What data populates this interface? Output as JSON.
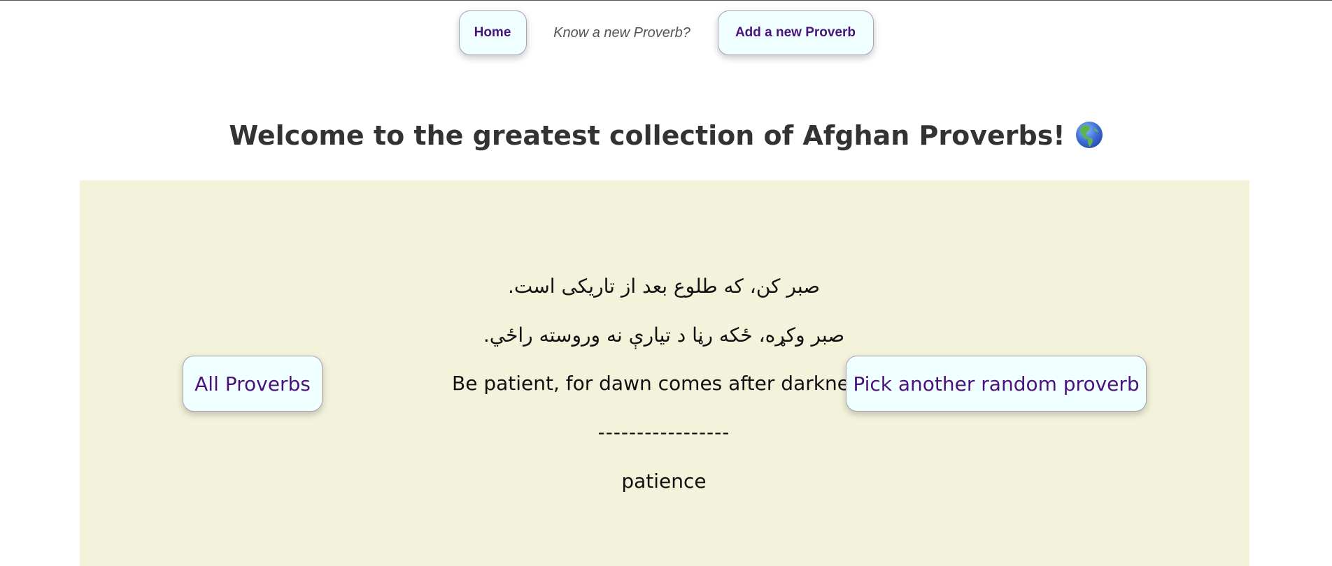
{
  "nav": {
    "home_label": "Home",
    "prompt": "Know a new Proverb?",
    "add_label": "Add a new Proverb"
  },
  "title": {
    "text": "Welcome to the greatest collection of Afghan Proverbs!",
    "icon": "globe-americas-icon"
  },
  "panel": {
    "all_button_label": "All Proverbs",
    "random_button_label": "Pick another random proverb",
    "proverb": {
      "dari": "صبر کن، که طلوع بعد از تاریکی است.",
      "pashto": "صبر وکړه، ځکه رڼا د تیارې نه وروسته راځي.",
      "english": "Be patient, for dawn comes after darkness.",
      "separator": "-----------------",
      "category": "patience"
    }
  },
  "colors": {
    "panel_background": "#f3f3db",
    "button_background": "#f0ffff",
    "button_text": "#4b137c",
    "title_text": "#333333"
  }
}
